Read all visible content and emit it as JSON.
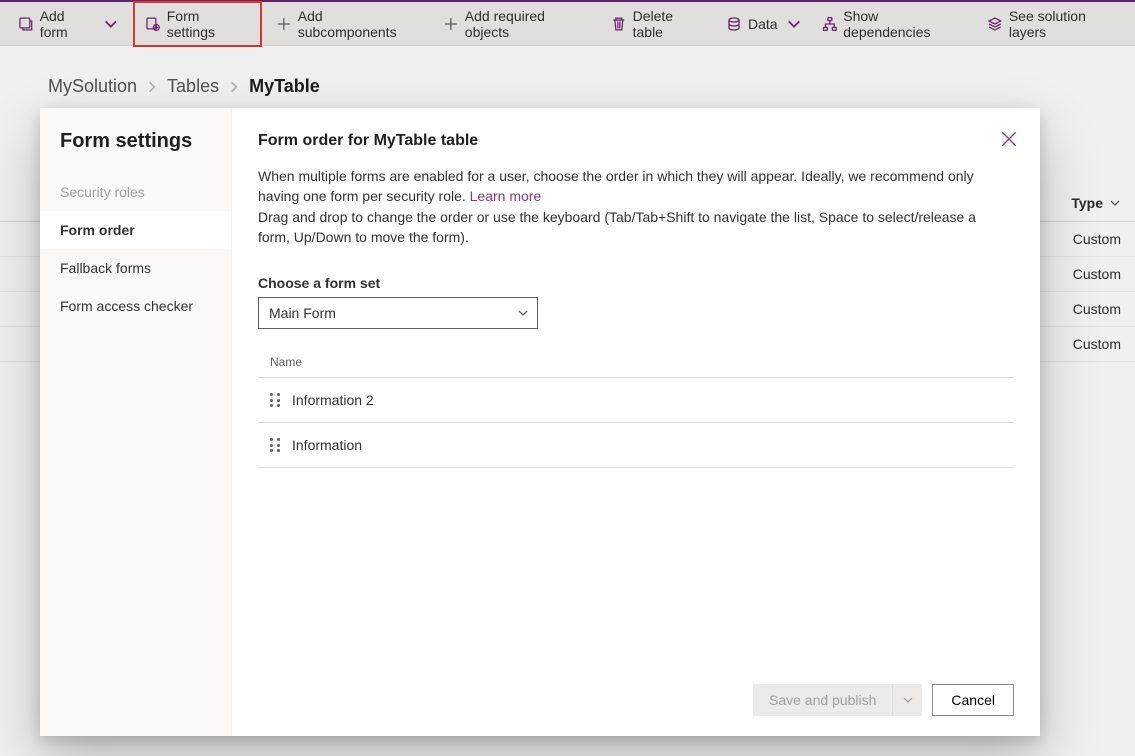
{
  "toolbar": {
    "add_form": "Add form",
    "form_settings": "Form settings",
    "add_subcomponents": "Add subcomponents",
    "add_required_objects": "Add required objects",
    "delete_table": "Delete table",
    "data": "Data",
    "show_dependencies": "Show dependencies",
    "see_solution_layers": "See solution layers"
  },
  "breadcrumbs": {
    "solution": "MySolution",
    "tables": "Tables",
    "current": "MyTable"
  },
  "bg_table": {
    "header_type": "Type",
    "rows": [
      "Custom",
      "Custom",
      "Custom",
      "Custom"
    ]
  },
  "dialog": {
    "sidebar_title": "Form settings",
    "sidebar_items": {
      "security_roles": "Security roles",
      "form_order": "Form order",
      "fallback_forms": "Fallback forms",
      "form_access_checker": "Form access checker"
    },
    "title": "Form order for MyTable table",
    "desc_line1": "When multiple forms are enabled for a user, choose the order in which they will appear. Ideally, we recommend only having one form per security role. ",
    "learn_more": "Learn more",
    "desc_line2": "Drag and drop to change the order or use the keyboard (Tab/Tab+Shift to navigate the list, Space to select/release a form, Up/Down to move the form).",
    "field_label": "Choose a form set",
    "selected_form_set": "Main Form",
    "list_header": "Name",
    "forms": [
      "Information 2",
      "Information"
    ],
    "save_publish": "Save and publish",
    "cancel": "Cancel"
  }
}
